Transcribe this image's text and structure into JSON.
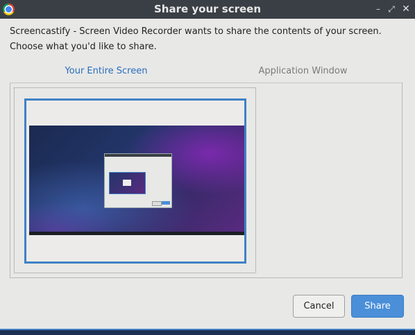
{
  "window": {
    "title": "Share your screen",
    "app_icon": "chrome-icon",
    "controls": {
      "minimize": "–",
      "maximize": "⤢",
      "close": "✕"
    }
  },
  "prompt": {
    "line1": "Screencastify - Screen Video Recorder wants to share the contents of your screen.",
    "line2": "Choose what you'd like to share."
  },
  "tabs": [
    {
      "label": "Your Entire Screen",
      "selected": true
    },
    {
      "label": "Application Window",
      "selected": false
    }
  ],
  "buttons": {
    "cancel": "Cancel",
    "share": "Share"
  },
  "colors": {
    "accent": "#4a8fd8",
    "titlebar": "#3a3f45"
  }
}
